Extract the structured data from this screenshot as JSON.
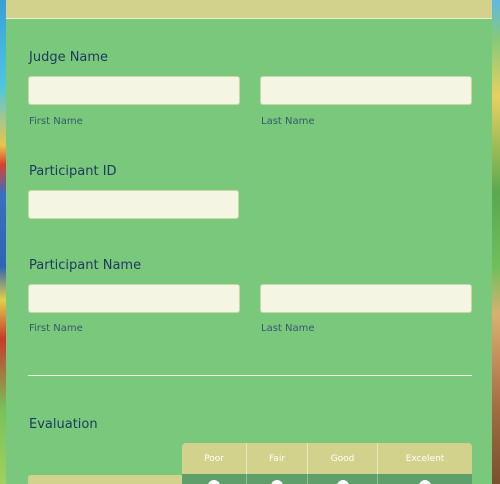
{
  "form": {
    "judge_name": {
      "label": "Judge Name",
      "first_sublabel": "First Name",
      "last_sublabel": "Last Name",
      "first_value": "",
      "last_value": ""
    },
    "participant_id": {
      "label": "Participant ID",
      "value": ""
    },
    "participant_name": {
      "label": "Participant Name",
      "first_sublabel": "First Name",
      "last_sublabel": "Last Name",
      "first_value": "",
      "last_value": ""
    },
    "evaluation": {
      "label": "Evaluation",
      "columns": [
        "Poor",
        "Fair",
        "Good",
        "Excelent"
      ]
    }
  },
  "colors": {
    "card": "#79c87c",
    "header_bar": "#d3d28d",
    "input": "#f4f6e3",
    "label_text": "#1e3a5c"
  }
}
